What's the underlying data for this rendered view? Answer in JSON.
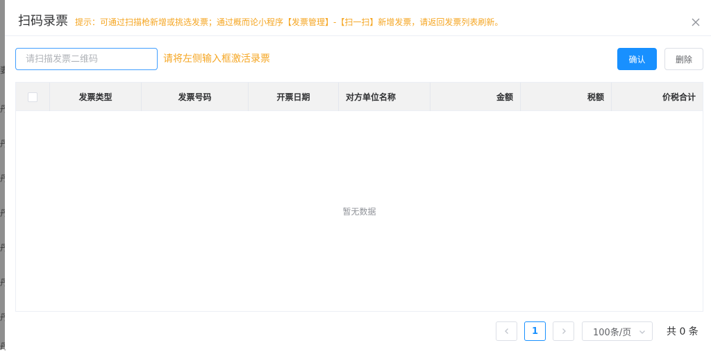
{
  "background": {
    "fragments": [
      "妻",
      "丹",
      "丹",
      "丹",
      "丹",
      "丹",
      "丹",
      "丹",
      "丹"
    ]
  },
  "dialog": {
    "title": "扫码录票",
    "tip": "提示：可通过扫描枪新增或挑选发票；通过概而论小程序【发票管理】-【扫一扫】新增发票，请返回发票列表刷新。",
    "close_icon": "close-icon"
  },
  "toolbar": {
    "scan_placeholder": "请扫描发票二维码",
    "scan_value": "",
    "hint": "请将左侧输入框激活录票",
    "confirm_label": "确认",
    "delete_label": "删除"
  },
  "table": {
    "columns": [
      "",
      "发票类型",
      "发票号码",
      "开票日期",
      "对方单位名称",
      "金额",
      "税额",
      "价税合计"
    ],
    "rows": [],
    "empty_text": "暂无数据"
  },
  "pagination": {
    "current_page": "1",
    "page_size": "100条/页",
    "total": "共 0 条"
  },
  "colors": {
    "primary": "#1890ff",
    "warning_text": "#f5a623",
    "header_bg": "#f2f2f2"
  }
}
